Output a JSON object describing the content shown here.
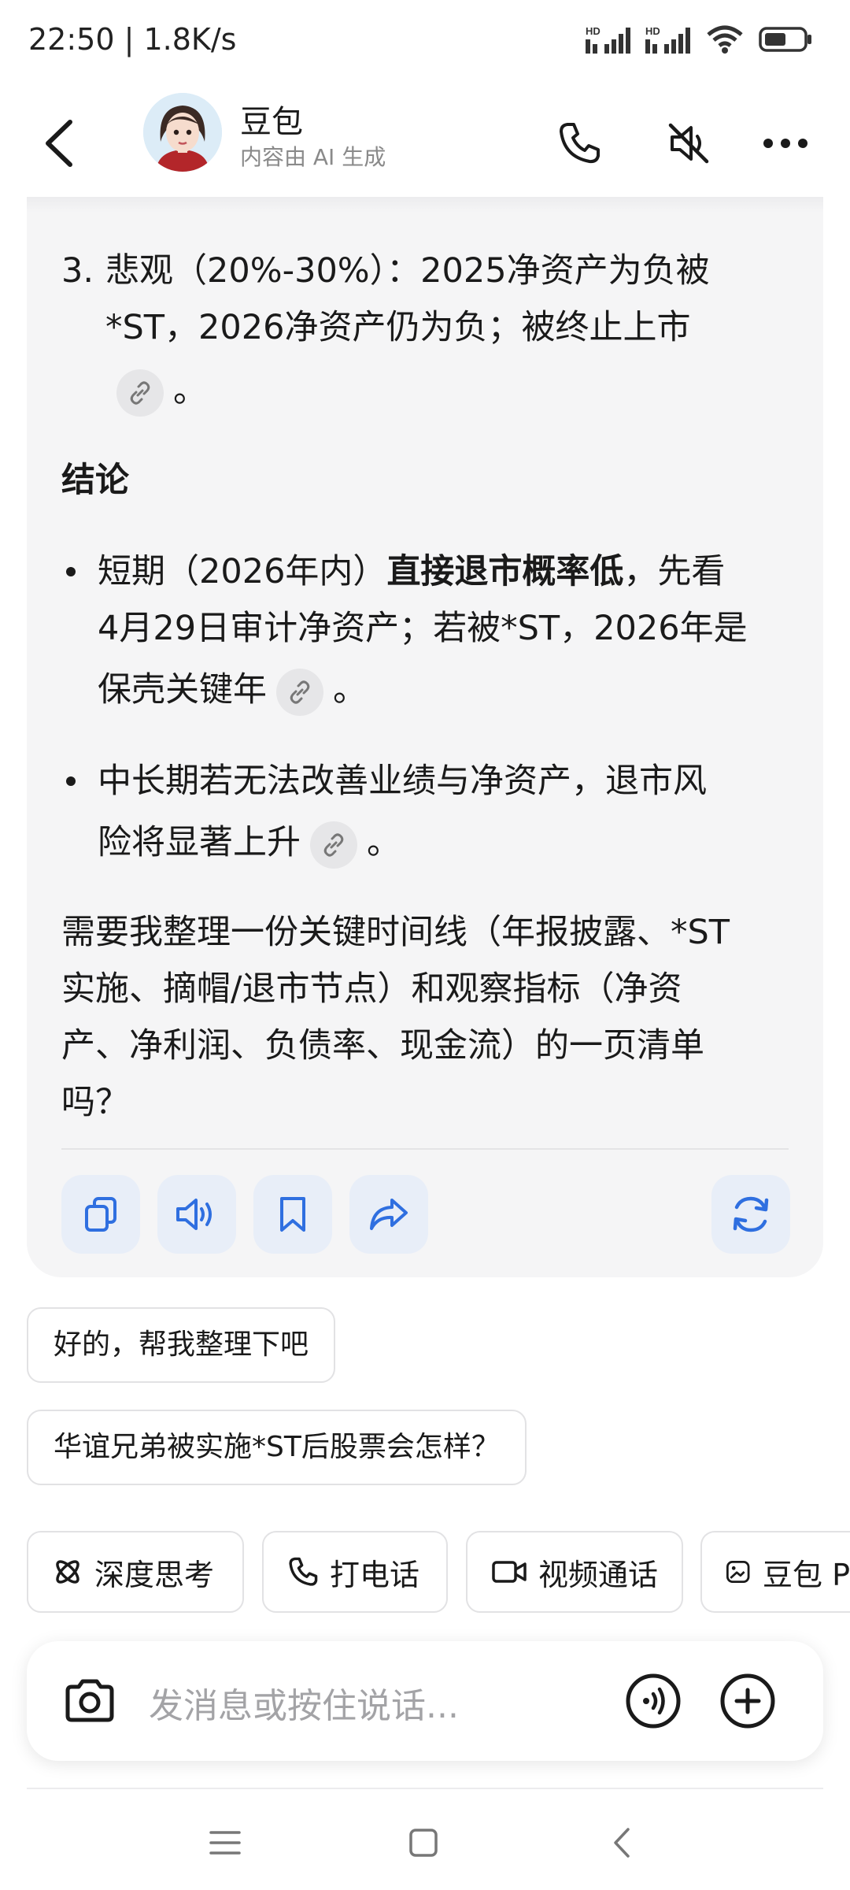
{
  "status_bar": {
    "time": "22:50 | 1.8K/s",
    "net1": "HD",
    "net2": "HD"
  },
  "header": {
    "name": "豆包",
    "subtitle": "内容由 AI 生成"
  },
  "message": {
    "item3_prefix": "3.",
    "item3_line1": "悲观（20%-30%）：2025净资产为负被",
    "item3_line2": "*ST，2026净资产仍为负；被终止上市",
    "item3_end": "。",
    "conclusion_title": "结论",
    "b1_l1_a": "短期（2026年内）",
    "b1_l1_b": "直接退市概率低",
    "b1_l1_c": "，先看",
    "b1_l2": "4月29日审计净资产；若被*ST，2026年是",
    "b1_l3": "保壳关键年",
    "b1_end": "。",
    "b2_l1": "中长期若无法改善业绩与净资产，退市风",
    "b2_l2": "险将显著上升",
    "b2_end": "。",
    "q_l1": "需要我整理一份关键时间线（年报披露、*ST",
    "q_l2": "实施、摘帽/退市节点）和观察指标（净资",
    "q_l3": "产、净利润、负债率、现金流）的一页清单",
    "q_l4": "吗？"
  },
  "suggestions": [
    "好的，帮我整理下吧",
    "华谊兄弟被实施*ST后股票会怎样？"
  ],
  "tools": [
    "深度思考",
    "打电话",
    "视频通话",
    "豆包 P"
  ],
  "input": {
    "placeholder": "发消息或按住说话..."
  },
  "colors": {
    "accent": "#2f6fe0",
    "card_bg": "#f5f5f6",
    "action_bg": "#e8eef8"
  },
  "icons": [
    "back-icon",
    "phone-icon",
    "speaker-muted-icon",
    "more-icon",
    "link-icon",
    "copy-icon",
    "speaker-icon",
    "bookmark-icon",
    "share-icon",
    "regenerate-icon",
    "atom-icon",
    "camera-icon",
    "voice-icon",
    "plus-icon",
    "menu-icon",
    "home-icon",
    "back-nav-icon"
  ]
}
